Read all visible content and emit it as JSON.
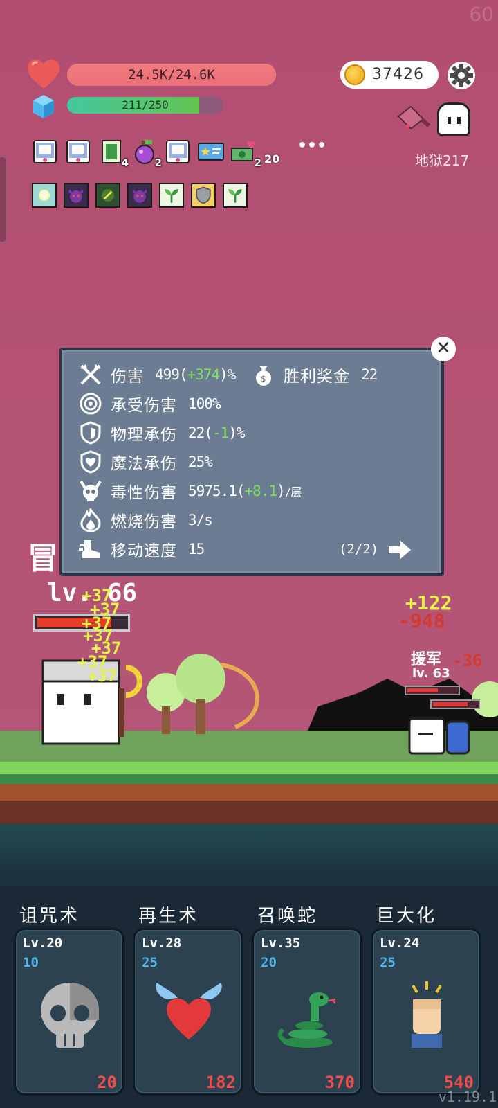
{
  "hud": {
    "fps": "60",
    "hp_text": "24.5K/24.6K",
    "hp_fraction": 0.996,
    "mp_text": "211/250",
    "mp_fraction": 0.844,
    "gold": "37426",
    "stage": "地狱217"
  },
  "items": [
    {
      "icon": "scroll-icon",
      "count": ""
    },
    {
      "icon": "scroll-icon",
      "count": ""
    },
    {
      "icon": "green-card-icon",
      "count": "4"
    },
    {
      "icon": "potion-icon",
      "count": "2"
    },
    {
      "icon": "scroll-icon",
      "count": ""
    },
    {
      "icon": "star-card-icon",
      "count": ""
    },
    {
      "icon": "cash-heart-icon",
      "count": "2"
    }
  ],
  "items_more_count": "20",
  "items_more_dots": "•••",
  "buffs": [
    {
      "icon": "light-buff-icon",
      "bg": "#9fd9d4"
    },
    {
      "icon": "demon-buff-icon",
      "bg": "#3b2b4a"
    },
    {
      "icon": "leaf-buff-icon",
      "bg": "#2f5030"
    },
    {
      "icon": "demon-buff-icon",
      "bg": "#3b2b4a"
    },
    {
      "icon": "sprout-buff-icon",
      "bg": "#eef6e6"
    },
    {
      "icon": "shield-buff-icon",
      "bg": "#f6cf66"
    },
    {
      "icon": "sprout-buff-icon",
      "bg": "#eef6e6"
    }
  ],
  "stats": {
    "damage_label": "伤害",
    "damage_value": "499(",
    "damage_delta": "+374",
    "damage_suffix": ")%",
    "bonus_label": "胜利奖金",
    "bonus_value": "22",
    "taken_label": "承受伤害",
    "taken_value": "100%",
    "phys_label": "物理承伤",
    "phys_value": "22(",
    "phys_delta": "-1",
    "phys_suffix": ")%",
    "magic_label": "魔法承伤",
    "magic_value": "25%",
    "poison_label": "毒性伤害",
    "poison_value": "5975.1(",
    "poison_delta": "+8.1",
    "poison_suffix": ")",
    "poison_unit": "/层",
    "burn_label": "燃烧伤害",
    "burn_value": "3/s",
    "speed_label": "移动速度",
    "speed_value": "15",
    "page": "(2/2)"
  },
  "player": {
    "title_partial": "冒",
    "level": "lv. 66",
    "hp_fraction": 0.8
  },
  "floating_heals": [
    "+37",
    "+37",
    "+37",
    "+37",
    "+37",
    "+37",
    "+37"
  ],
  "enemy": {
    "heal": "+122",
    "damage": "-948",
    "damage2": "-36",
    "label": "援军",
    "level": "lv. 63"
  },
  "skills": [
    {
      "name": "诅咒术",
      "level": "Lv.20",
      "cost": "10",
      "value": "20",
      "icon": "skull-icon"
    },
    {
      "name": "再生术",
      "level": "Lv.28",
      "cost": "25",
      "value": "182",
      "icon": "winged-heart-icon"
    },
    {
      "name": "召唤蛇",
      "level": "Lv.35",
      "cost": "20",
      "value": "370",
      "icon": "snake-icon"
    },
    {
      "name": "巨大化",
      "level": "Lv.24",
      "cost": "25",
      "value": "540",
      "icon": "fist-icon"
    }
  ],
  "version": "v1.19.1",
  "colors": {
    "sky": "#b24f72",
    "hp": "#ee6f78",
    "mp": "#55c67a",
    "popup": "#6c7d93",
    "delta_green": "#7ee061",
    "heal_yellow": "#e5f24a",
    "damage_red": "#d33a32",
    "skill_cost_blue": "#4db2e8",
    "skill_value_red": "#ef4b4b"
  }
}
